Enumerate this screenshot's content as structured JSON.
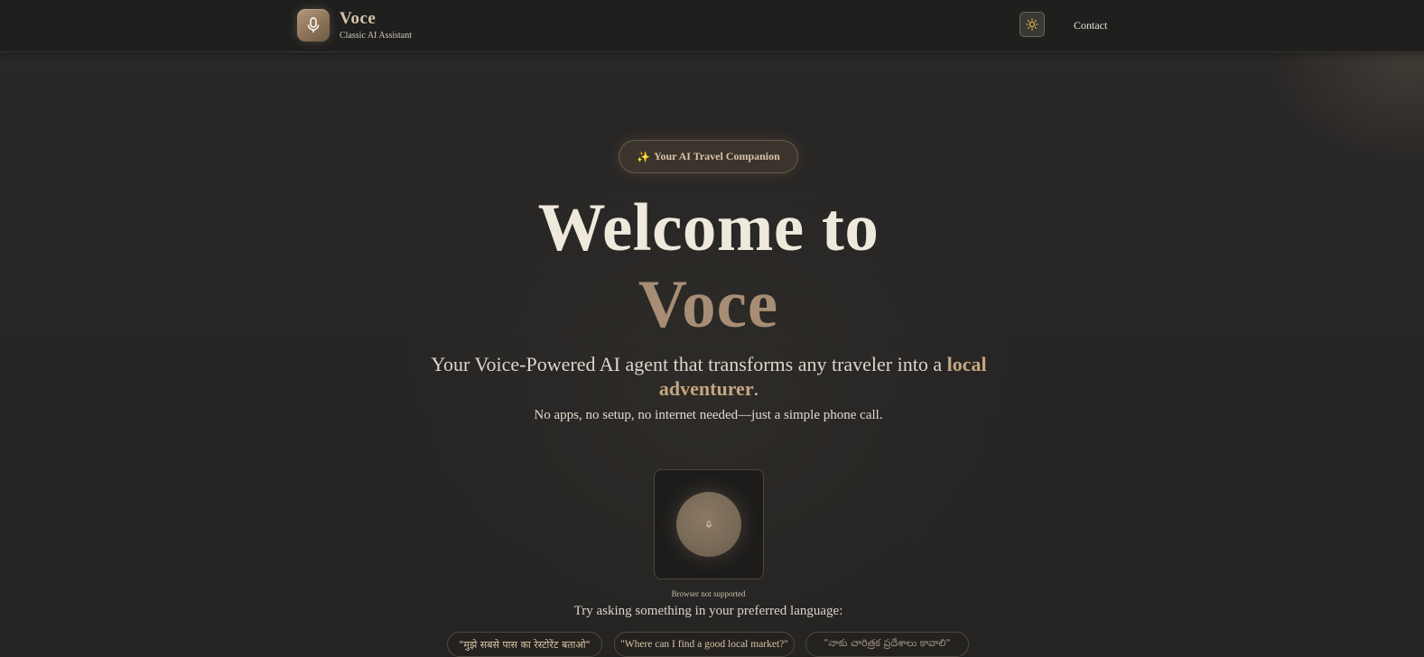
{
  "header": {
    "brand_name": "Voce",
    "brand_subtitle": "Classic AI Assistant",
    "logo_icon": "microphone-icon",
    "theme_toggle_icon": "sun-icon",
    "contact_label": "Contact"
  },
  "hero": {
    "badge_icon": "✨",
    "badge_text": "Your AI Travel Companion",
    "title_line1": "Welcome to",
    "title_line2": "Voce",
    "tagline_main": "Your Voice-Powered AI agent that transforms any traveler into a ",
    "tagline_highlight": "local adventurer",
    "tagline_end": ".",
    "subline": "No apps, no setup, no internet needed—just a simple phone call."
  },
  "voice": {
    "mic_icon": "microphone-icon",
    "status": "Browser not supported",
    "try_label": "Try asking something in your preferred language:",
    "examples": [
      "\"मुझे सबसे पास का रेस्टोरेंट बताओ\"",
      "\"Where can I find a good local market?\"",
      "\"నాకు చారిత్రక ప్రదేశాలు కావాలి\""
    ]
  },
  "colors": {
    "background": "#272625",
    "accent": "#a78d75",
    "accent_light": "#c4a582",
    "sun_icon": "#e8b84a"
  }
}
